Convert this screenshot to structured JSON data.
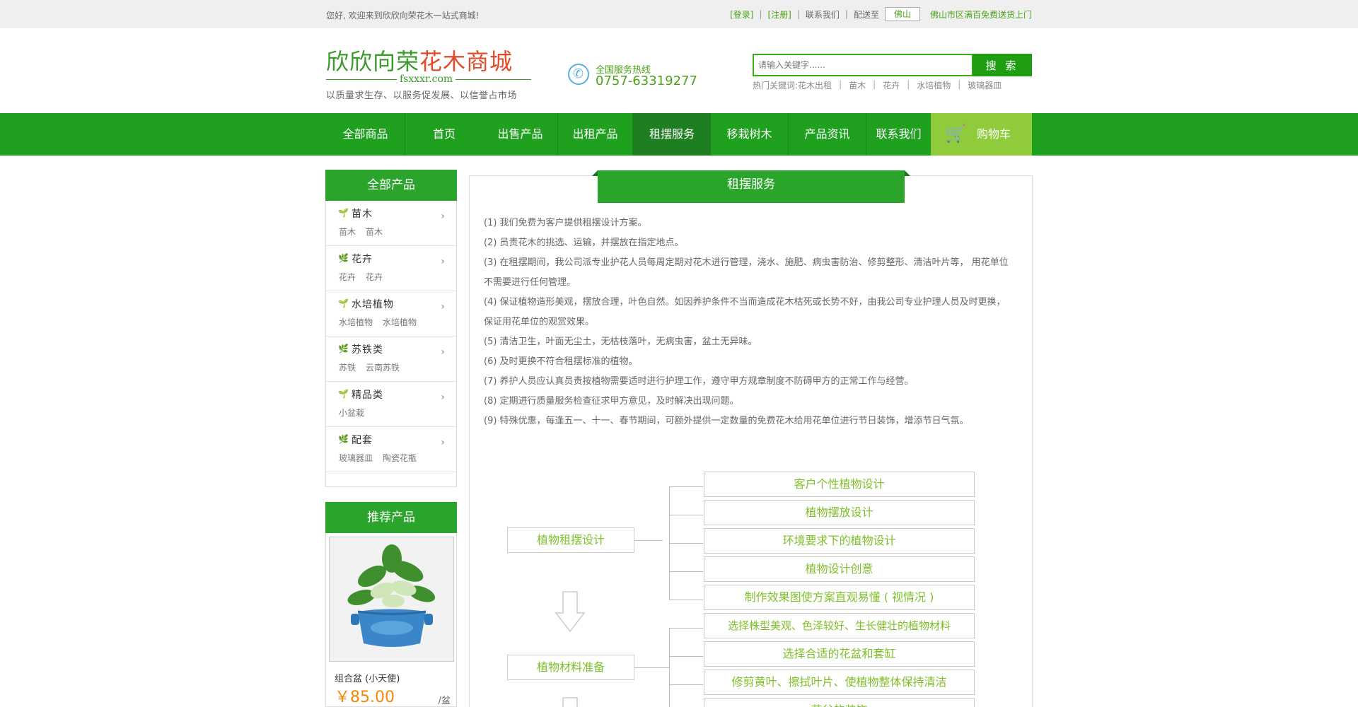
{
  "topbar": {
    "welcome": "您好, 欢迎来到欣欣向荣花木一站式商城!",
    "login": "[登录]",
    "register": "[注册]",
    "contact": "联系我们",
    "deliver_to": "配送至",
    "city": "佛山",
    "free_delivery": "佛山市区满百免费送货上门"
  },
  "header": {
    "logo_green": "欣欣向荣",
    "logo_red": "花木商城",
    "logo_domain": "fsxxxr.com",
    "slogan": "以质量求生存、以服务促发展、以信誉占市场",
    "hotline_label": "全国服务热线",
    "hotline_number": "0757-63319277",
    "search_placeholder": "请输入关键字......",
    "search_button": "搜 索",
    "hot_label": "热门关键词:",
    "hot_words": [
      "花木出租",
      "苗木",
      "花卉",
      "水培植物",
      "玻璃器皿"
    ]
  },
  "nav": {
    "items": [
      "全部商品",
      "首页",
      "出售产品",
      "出租产品",
      "租摆服务",
      "移栽树木",
      "产品资讯",
      "联系我们"
    ],
    "active": "租摆服务",
    "cart": "购物车"
  },
  "sidebar": {
    "title": "全部产品",
    "categories": [
      {
        "name": "苗木",
        "subs": [
          "苗木",
          "苗木"
        ]
      },
      {
        "name": "花卉",
        "subs": [
          "花卉",
          "花卉"
        ]
      },
      {
        "name": "水培植物",
        "subs": [
          "水培植物",
          "水培植物"
        ]
      },
      {
        "name": "苏铁类",
        "subs": [
          "苏铁",
          "云南苏铁"
        ]
      },
      {
        "name": "精品类",
        "subs": [
          "小盆栽"
        ]
      },
      {
        "name": "配套",
        "subs": [
          "玻璃器皿",
          "陶瓷花瓶"
        ]
      }
    ],
    "recommend_title": "推荐产品",
    "recommend": {
      "name": "组合盆 (小天使)",
      "price": "￥85.00",
      "unit": "/盆"
    }
  },
  "main": {
    "title": "租摆服务",
    "paragraphs": [
      "(1) 我们免费为客户提供租摆设计方案。",
      "(2) 员责花木的挑选、运输，并摆放在指定地点。",
      "(3) 在租摆期间，我公司派专业护花人员每周定期对花木进行管理，浇水、施肥、病虫害防治、修剪整形、清洁叶片等，  用花单位不需要进行任何管理。",
      "(4) 保证植物造形美观，摆放合理，叶色自然。如因养护条件不当而造成花木枯死或长势不好，由我公司专业护理人员及时更换，保证用花单位的观赏效果。",
      "(5) 清洁卫生，叶面无尘土，无枯枝落叶，无病虫害，盆土无异味。",
      "(6) 及时更换不符合租摆标准的植物。",
      "(7) 养护人员应认真员责按植物需要适时进行护理工作，遵守甲方规章制度不防碍甲方的正常工作与经营。",
      "(8) 定期进行质量服务检查征求甲方意见，及时解决出现问题。",
      "(9) 特殊优惠，每逢五一、十一、春节期间，可额外提供一定数量的免费花木给用花单位进行节日装饰，增添节日气氛。"
    ],
    "flow": {
      "left": [
        "植物租摆设计",
        "植物材料准备"
      ],
      "right": [
        "客户个性植物设计",
        "植物摆放设计",
        "环境要求下的植物设计",
        "植物设计创意",
        "制作效果图使方案直观易懂 ( 视情况 )",
        "选择株型美观、色泽较好、生长健壮的植物材料",
        "选择合适的花盆和套缸",
        "修剪黄叶、擦拭叶片、使植物整体保持清洁",
        "花盆的装饰"
      ]
    }
  },
  "colors": {
    "brand_green": "#1fa01f",
    "nav_active": "#1d7f22",
    "cart_green": "#8fcb3a",
    "price_orange": "#f5880a",
    "flow_text": "#7fbf2a"
  }
}
